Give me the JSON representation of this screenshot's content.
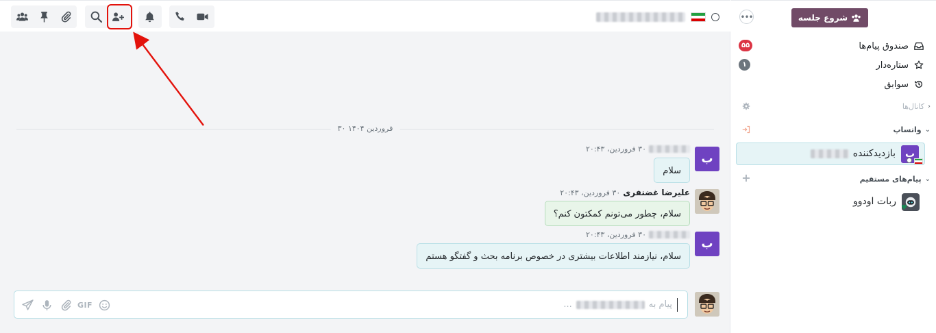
{
  "topbar": {
    "icons": {
      "members": "members-icon",
      "pinned": "pin-icon",
      "attachments": "paperclip-icon",
      "search": "search-icon",
      "add_users": "user-plus-icon",
      "notifications": "bell-icon",
      "call": "phone-icon",
      "video": "video-camera-icon"
    },
    "highlight_color": "#e3120b"
  },
  "thread": {
    "date_separator": "۳۰ فروردین ۱۴۰۴",
    "messages": [
      {
        "avatar_letter": "ب",
        "author": "",
        "time": "۳۰ فروردین، ۲۰:۴۳",
        "text": "سلام",
        "kind": "incoming"
      },
      {
        "avatar_letter": "",
        "author": "علیرضا غضنفری",
        "time": "۳۰ فروردین، ۲۰:۴۳",
        "text": "سلام، چطور می‌تونم کمکتون کنم؟",
        "kind": "outgoing"
      },
      {
        "avatar_letter": "ب",
        "author": "",
        "time": "۳۰ فروردین، ۲۰:۴۳",
        "text": "سلام، نیازمند اطلاعات بیشتری در خصوص برنامه بحث و گفتگو هستم",
        "kind": "incoming"
      }
    ]
  },
  "composer": {
    "placeholder": "پیام به",
    "placeholder_suffix": "...",
    "gif_label": "GIF"
  },
  "sidebar": {
    "start_meeting_label": "شروع جلسه",
    "mailboxes": [
      {
        "label": "صندوق پیام‌ها",
        "icon": "inbox-icon",
        "count": "۵۵",
        "count_color": "#dc3545"
      },
      {
        "label": "ستاره‌دار",
        "icon": "star-icon",
        "count": "۱",
        "count_color": "#6c757d"
      },
      {
        "label": "سوابق",
        "icon": "history-icon",
        "count": "",
        "count_color": ""
      }
    ],
    "categories": {
      "channels": "کانال‌ها",
      "whatsapp": "واتساپ",
      "direct_messages": "پیام‌های مستقیم"
    },
    "visitor": {
      "avatar_letter": "ب",
      "name_prefix": "بازدیدکننده"
    },
    "bot": {
      "name": "ربات اودوو"
    }
  },
  "colors": {
    "brand": "#714b67",
    "avatar_purple": "#6f42c1",
    "bubble_incoming": "#e6f4f6",
    "bubble_outgoing": "#e8f5e9"
  }
}
